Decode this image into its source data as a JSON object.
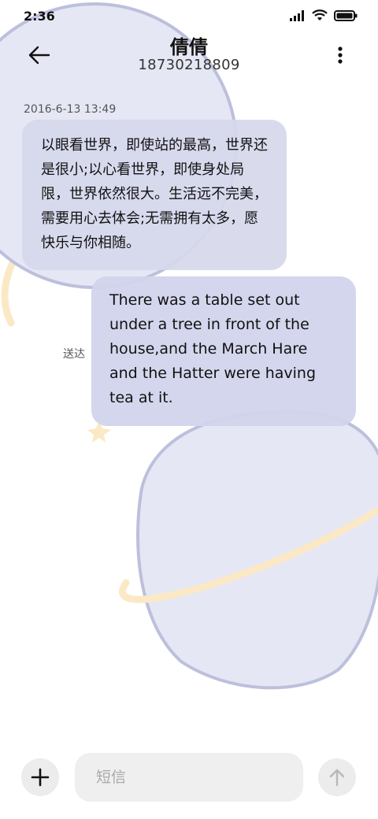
{
  "status_bar": {
    "time": "2:36"
  },
  "header": {
    "contact_name": "倩倩",
    "phone_number": "18730218809"
  },
  "conversation": {
    "timestamp": "2016-6-13 13:49",
    "messages": [
      {
        "direction": "incoming",
        "text": "以眼看世界，即使站的最高，世界还是很小;以心看世界，即使身处局限，世界依然很大。生活远不完美，需要用心去体会;无需拥有太多，愿快乐与你相随。"
      },
      {
        "direction": "outgoing",
        "text": "There was a table set out under a tree in front of the house,and the March Hare and the Hatter were having tea at it.",
        "status": "送达"
      }
    ]
  },
  "compose": {
    "placeholder": "短信"
  },
  "colors": {
    "bubble": "#d6d8ec",
    "planet": "#e6e7f4",
    "planet_outline": "#bcc0dc",
    "ring": "#fbe9c6"
  }
}
